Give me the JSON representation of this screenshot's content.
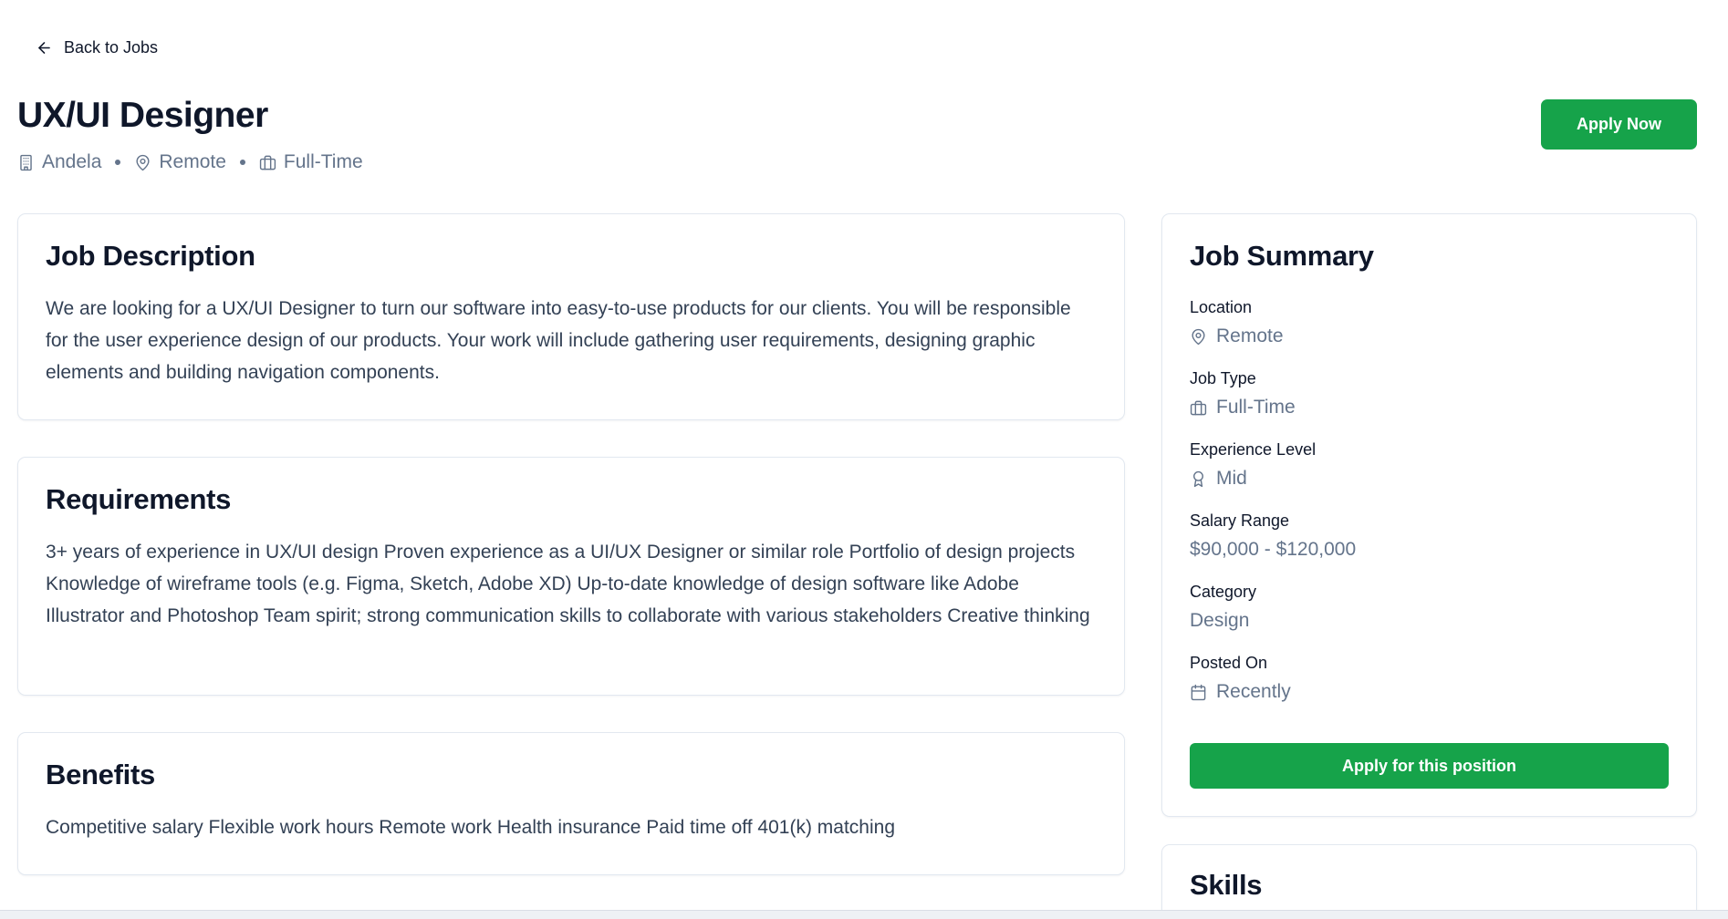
{
  "nav": {
    "back_label": "Back to Jobs"
  },
  "job": {
    "title": "UX/UI Designer",
    "company": "Andela",
    "location": "Remote",
    "type": "Full-Time"
  },
  "actions": {
    "apply_now": "Apply Now",
    "apply_position": "Apply for this position"
  },
  "description": {
    "heading": "Job Description",
    "text": "We are looking for a UX/UI Designer to turn our software into easy-to-use products for our clients. You will be responsible for the user experience design of our products. Your work will include gathering user requirements, designing graphic elements and building navigation components."
  },
  "requirements": {
    "heading": "Requirements",
    "text": "3+ years of experience in UX/UI design Proven experience as a UI/UX Designer or similar role Portfolio of design projects Knowledge of wireframe tools (e.g. Figma, Sketch, Adobe XD) Up-to-date knowledge of design software like Adobe Illustrator and Photoshop Team spirit; strong communication skills to collaborate with various stakeholders Creative thinking"
  },
  "benefits": {
    "heading": "Benefits",
    "text": "Competitive salary Flexible work hours Remote work Health insurance Paid time off 401(k) matching"
  },
  "summary": {
    "heading": "Job Summary",
    "fields": [
      {
        "label": "Location",
        "value": "Remote",
        "icon": "map-pin-icon"
      },
      {
        "label": "Job Type",
        "value": "Full-Time",
        "icon": "briefcase-icon"
      },
      {
        "label": "Experience Level",
        "value": "Mid",
        "icon": "award-icon"
      },
      {
        "label": "Salary Range",
        "value": "$90,000 - $120,000",
        "icon": ""
      },
      {
        "label": "Category",
        "value": "Design",
        "icon": ""
      },
      {
        "label": "Posted On",
        "value": "Recently",
        "icon": "calendar-icon"
      }
    ]
  },
  "skills": {
    "heading": "Skills"
  },
  "colors": {
    "accent": "#16a34a",
    "muted_text": "#64748b",
    "body_text": "#334155",
    "border": "#e2e8f0"
  }
}
